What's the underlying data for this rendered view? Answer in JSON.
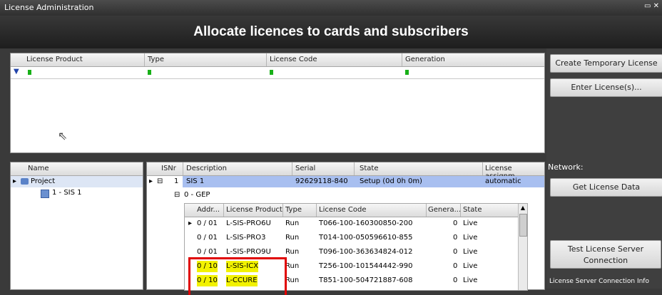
{
  "window": {
    "title": "License Administration",
    "controls": "▭ ✕"
  },
  "banner": {
    "title": "Allocate licences to cards and subscribers"
  },
  "license_grid": {
    "columns": [
      "License Product",
      "Type",
      "License Code",
      "Generation"
    ],
    "filter_icon": "filter-icon"
  },
  "buttons": {
    "create_temp": "Create Temporary License",
    "enter_license": "Enter License(s)...",
    "get_license_data": "Get License Data",
    "test_server": "Test License Server Connection"
  },
  "network": {
    "label": "Network:",
    "info_label": "License Server Connection Info"
  },
  "tree": {
    "header": "Name",
    "project": "Project",
    "child": "1 - SIS 1"
  },
  "cards": {
    "columns": [
      "ISNr",
      "Description",
      "Serial",
      "State",
      "License assignm..."
    ],
    "row": {
      "isnr": "1",
      "description": "SIS 1",
      "serial": "92629118-840",
      "state": "Setup (0d 0h 0m)",
      "assign": "automatic"
    },
    "group": "0 - GEP",
    "sub_columns": [
      "Addr...",
      "License Product",
      "Type",
      "License Code",
      "Genera...",
      "State"
    ],
    "sub_rows": [
      {
        "addr": "0 / 01",
        "product": "L-SIS-PRO6U",
        "type": "Run",
        "code": "T066-100-160300850-200",
        "gen": "0",
        "state": "Live"
      },
      {
        "addr": "0 / 01",
        "product": "L-SIS-PRO3",
        "type": "Run",
        "code": "T014-100-050596610-855",
        "gen": "0",
        "state": "Live"
      },
      {
        "addr": "0 / 01",
        "product": "L-SIS-PRO9U",
        "type": "Run",
        "code": "T096-100-363634824-012",
        "gen": "0",
        "state": "Live"
      },
      {
        "addr": "0 / 10",
        "product": "L-SIS-ICX",
        "type": "Run",
        "code": "T256-100-101544442-990",
        "gen": "0",
        "state": "Live"
      },
      {
        "addr": "0 / 10",
        "product": "L-CCURE",
        "type": "Run",
        "code": "T851-100-504721887-608",
        "gen": "0",
        "state": "Live"
      }
    ]
  }
}
